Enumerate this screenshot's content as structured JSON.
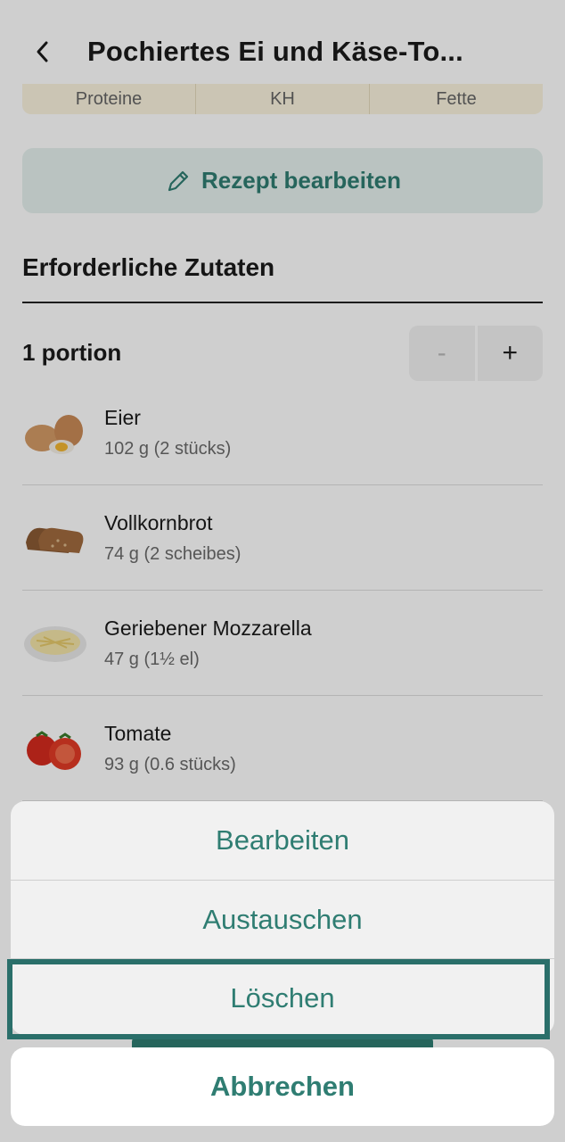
{
  "header": {
    "title": "Pochiertes Ei und Käse-To...",
    "back_icon": "chevron-left-icon"
  },
  "macros": [
    "Proteine",
    "KH",
    "Fette"
  ],
  "edit_recipe": {
    "label": "Rezept bearbeiten",
    "icon": "pencil-icon"
  },
  "ingredients_section": {
    "title": "Erforderliche Zutaten",
    "portion_label": "1 portion",
    "stepper": {
      "minus": "-",
      "plus": "+"
    },
    "items": [
      {
        "name": "Eier",
        "amount": "102 g (2 stücks)",
        "icon": "egg-icon"
      },
      {
        "name": "Vollkornbrot",
        "amount": "74 g (2 scheibes)",
        "icon": "bread-icon"
      },
      {
        "name": "Geriebener Mozzarella",
        "amount": "47 g (1½ el)",
        "icon": "cheese-icon"
      },
      {
        "name": "Tomate",
        "amount": "93 g (0.6 stücks)",
        "icon": "tomato-icon"
      }
    ]
  },
  "action_sheet": {
    "items": [
      "Bearbeiten",
      "Austauschen",
      "Löschen"
    ],
    "highlighted": "Löschen",
    "cancel": "Abbrechen"
  },
  "colors": {
    "accent": "#2f7d72",
    "macro_bg": "#fbf3de",
    "edit_bg": "#e6f1ee"
  }
}
